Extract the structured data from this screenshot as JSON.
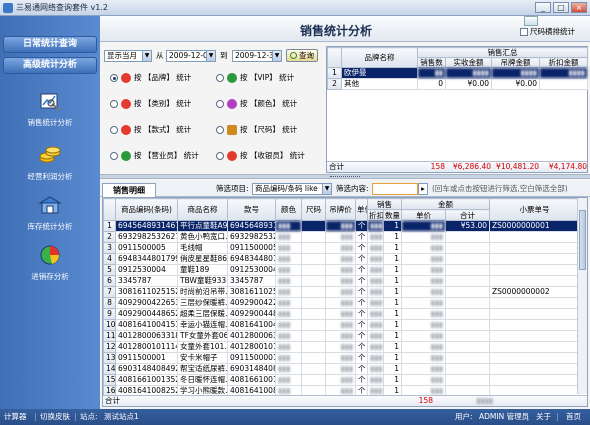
{
  "window": {
    "title": "三易通网络查询套件 v1.2",
    "buttons": [
      "_",
      "□",
      "×"
    ]
  },
  "sidebar": {
    "sections": [
      "日常统计查询",
      "高级统计分析"
    ],
    "items": [
      {
        "label": "销售统计分析",
        "icon": "sales-chart-icon"
      },
      {
        "label": "经营利润分析",
        "icon": "coins-icon"
      },
      {
        "label": "库存统计分析",
        "icon": "warehouse-icon"
      },
      {
        "label": "进销存分析",
        "icon": "pie-chart-icon"
      }
    ]
  },
  "header": {
    "title": "销售统计分析",
    "checkbox_label": "尺码横排统计"
  },
  "filter": {
    "period": "显示当月",
    "from_label": "从",
    "from_date": "2009-12-01",
    "to_label": "到",
    "to_date": "2009-12-31",
    "query_button": "查询",
    "options": [
      {
        "label": "按 【品牌】 统计",
        "selected": true,
        "icon_color": "#e23b2e"
      },
      {
        "label": "按 【VIP】 统计",
        "selected": false,
        "icon_color": "#2a9a3a"
      },
      {
        "label": "按 【类别】 统计",
        "selected": false,
        "icon_color": "#e23b2e"
      },
      {
        "label": "按 【颜色】 统计",
        "selected": false,
        "icon_color": "#b040c0"
      },
      {
        "label": "按 【款式】 统计",
        "selected": false,
        "icon_color": "#e23b2e"
      },
      {
        "label": "按 【尺码】 统计",
        "selected": false,
        "icon_color": "#d08a20"
      },
      {
        "label": "按 【营业员】 统计",
        "selected": false,
        "icon_color": "#2a9a3a"
      },
      {
        "label": "按 【收银员】 统计",
        "selected": false,
        "icon_color": "#e23b2e"
      }
    ]
  },
  "summary": {
    "col_brand": "品牌名称",
    "group_label": "销售汇总",
    "cols": [
      "销售数",
      "实收金额",
      "吊牌金额",
      "折扣金额"
    ],
    "rows": [
      {
        "idx": "1",
        "brand": "欧伊曼",
        "qty": "",
        "paid": "¥6,286.40",
        "tag": "¥10,481.20",
        "discount": "¥4,174.80",
        "selected": true
      },
      {
        "idx": "2",
        "brand": "其他",
        "qty": "0",
        "paid": "¥0.00",
        "tag": "¥0.00",
        "discount": "",
        "selected": false
      }
    ],
    "totals": {
      "label": "合计",
      "qty": "158",
      "paid": "¥6,286.40",
      "tag": "¥10,481.20",
      "discount": "¥4,174.80"
    }
  },
  "detail": {
    "tab_label": "销售明细",
    "filter_item_label": "筛选项目:",
    "filter_item_value": "商品编码/条码 like",
    "filter_content_label": "筛选内容:",
    "hint": "(回车或点击按钮进行筛选,空白筛选全部)",
    "headers": {
      "code": "商品编码(条码)",
      "name": "商品名称",
      "style": "款号",
      "color": "颜色",
      "size": "尺码",
      "tagprice": "吊牌价",
      "unit": "单位",
      "sales": "销售",
      "discount": "折扣",
      "qty": "数量",
      "amount": "金额",
      "price": "单价",
      "total": "合计",
      "ticket": "小票单号"
    },
    "rows": [
      {
        "idx": "1",
        "code": "6945648931467",
        "name": "平行点童鞋A9…",
        "style": "694564893146",
        "unit": "个",
        "qty": "1",
        "total": "¥53.00",
        "ticket": "ZS0000000001",
        "selected": true
      },
      {
        "idx": "2",
        "code": "6932982532627",
        "name": "黄色小鸭宽口…",
        "style": "693298253262",
        "unit": "个",
        "qty": "1",
        "total": "",
        "ticket": "",
        "selected": false
      },
      {
        "idx": "3",
        "code": "0911500005",
        "name": "毛线帽",
        "style": "0911500005",
        "unit": "个",
        "qty": "1",
        "total": "",
        "ticket": "",
        "selected": false
      },
      {
        "idx": "4",
        "code": "6948344801799",
        "name": "俏皮星星鞋865",
        "style": "694834480179",
        "unit": "个",
        "qty": "1",
        "total": "",
        "ticket": "",
        "selected": false
      },
      {
        "idx": "5",
        "code": "0912530004",
        "name": "童鞋189",
        "style": "0912530004",
        "unit": "个",
        "qty": "1",
        "total": "",
        "ticket": "",
        "selected": false
      },
      {
        "idx": "6",
        "code": "3345787",
        "name": "TBW童鞋933",
        "style": "3345787",
        "unit": "个",
        "qty": "1",
        "total": "",
        "ticket": "",
        "selected": false
      },
      {
        "idx": "7",
        "code": "3081611025152",
        "name": "时尚前沿吊带…",
        "style": "308161102515",
        "unit": "个",
        "qty": "1",
        "total": "",
        "ticket": "ZS0000000002",
        "selected": false
      },
      {
        "idx": "8",
        "code": "4092900422653",
        "name": "三层纱保暖裤…",
        "style": "409290042265",
        "unit": "个",
        "qty": "1",
        "total": "",
        "ticket": "",
        "selected": false
      },
      {
        "idx": "9",
        "code": "4092900448652",
        "name": "超柔三层保暖…",
        "style": "409290044865",
        "unit": "个",
        "qty": "1",
        "total": "",
        "ticket": "",
        "selected": false
      },
      {
        "idx": "10",
        "code": "4081641004151",
        "name": "幸运小猫连帽…",
        "style": "408164100415",
        "unit": "个",
        "qty": "1",
        "total": "",
        "ticket": "",
        "selected": false
      },
      {
        "idx": "11",
        "code": "4012800063318",
        "name": "TF女童外套06…",
        "style": "401280006331",
        "unit": "个",
        "qty": "1",
        "total": "",
        "ticket": "",
        "selected": false
      },
      {
        "idx": "12",
        "code": "4012800101114",
        "name": "女童外套101…",
        "style": "401280010111",
        "unit": "个",
        "qty": "1",
        "total": "",
        "ticket": "",
        "selected": false
      },
      {
        "idx": "13",
        "code": "0911500001",
        "name": "安卡米帽子",
        "style": "0911500001",
        "unit": "个",
        "qty": "1",
        "total": "",
        "ticket": "",
        "selected": false
      },
      {
        "idx": "14",
        "code": "6903148408492",
        "name": "帮宝适纸尿裤…",
        "style": "690314840849",
        "unit": "个",
        "qty": "1",
        "total": "",
        "ticket": "",
        "selected": false
      },
      {
        "idx": "15",
        "code": "4081661001352",
        "name": "冬日暖怀连帽…",
        "style": "408166100135",
        "unit": "个",
        "qty": "1",
        "total": "",
        "ticket": "",
        "selected": false
      },
      {
        "idx": "16",
        "code": "4081641008252",
        "name": "学习小熊暖款…",
        "style": "408164100825",
        "unit": "个",
        "qty": "1",
        "total": "",
        "ticket": "",
        "selected": false
      }
    ],
    "totals": {
      "label": "合计",
      "qty": "158"
    }
  },
  "statusbar": {
    "calculator": "计算器",
    "switch_skin": "切换皮肤",
    "station_label": "站点:",
    "station_value": "测试站点1",
    "user_label": "用户:",
    "user_value": "ADMIN 管理员",
    "about": "关于",
    "home": "首页"
  }
}
